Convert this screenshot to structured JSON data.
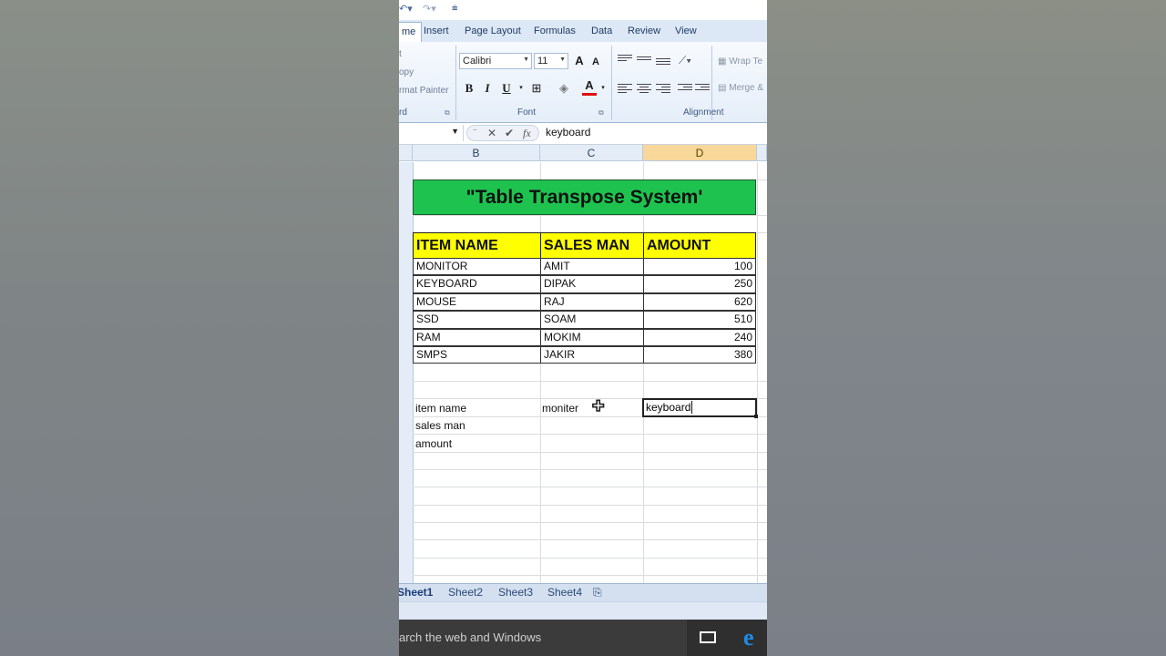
{
  "formula_bar": {
    "value": "keyboard",
    "fx": "fx"
  },
  "tabs": [
    "me",
    "Insert",
    "Page Layout",
    "Formulas",
    "Data",
    "Review",
    "View"
  ],
  "ribbon": {
    "clipboard": {
      "items": [
        "t",
        "opy",
        "rmat Painter"
      ],
      "label": "rd"
    },
    "font": {
      "name": "Calibri",
      "size": "11",
      "label": "Font",
      "bold": "B",
      "italic": "I",
      "underline": "U",
      "grow": "A",
      "shrink": "A",
      "color": "A"
    },
    "alignment": {
      "label": "Alignment",
      "wrap": "Wrap Te",
      "merge": "Merge &"
    }
  },
  "columns": [
    "B",
    "C",
    "D"
  ],
  "title": "\"Table Transpose System'",
  "table": {
    "headers": [
      "ITEM NAME",
      "SALES MAN",
      "AMOUNT"
    ],
    "rows": [
      [
        "MONITOR",
        "AMIT",
        "100"
      ],
      [
        "KEYBOARD",
        "DIPAK",
        "250"
      ],
      [
        "MOUSE",
        "RAJ",
        "620"
      ],
      [
        "SSD",
        "SOAM",
        "510"
      ],
      [
        "RAM",
        "MOKIM",
        "240"
      ],
      [
        "SMPS",
        "JAKIR",
        "380"
      ]
    ]
  },
  "transpose": {
    "labels": [
      "item name",
      "sales man",
      "amount"
    ],
    "c1": "moniter",
    "d1": "keyboard"
  },
  "sheets": [
    "Sheet1",
    "Sheet2",
    "Sheet3",
    "Sheet4"
  ],
  "taskbar": {
    "search_placeholder": "arch the web and Windows"
  }
}
